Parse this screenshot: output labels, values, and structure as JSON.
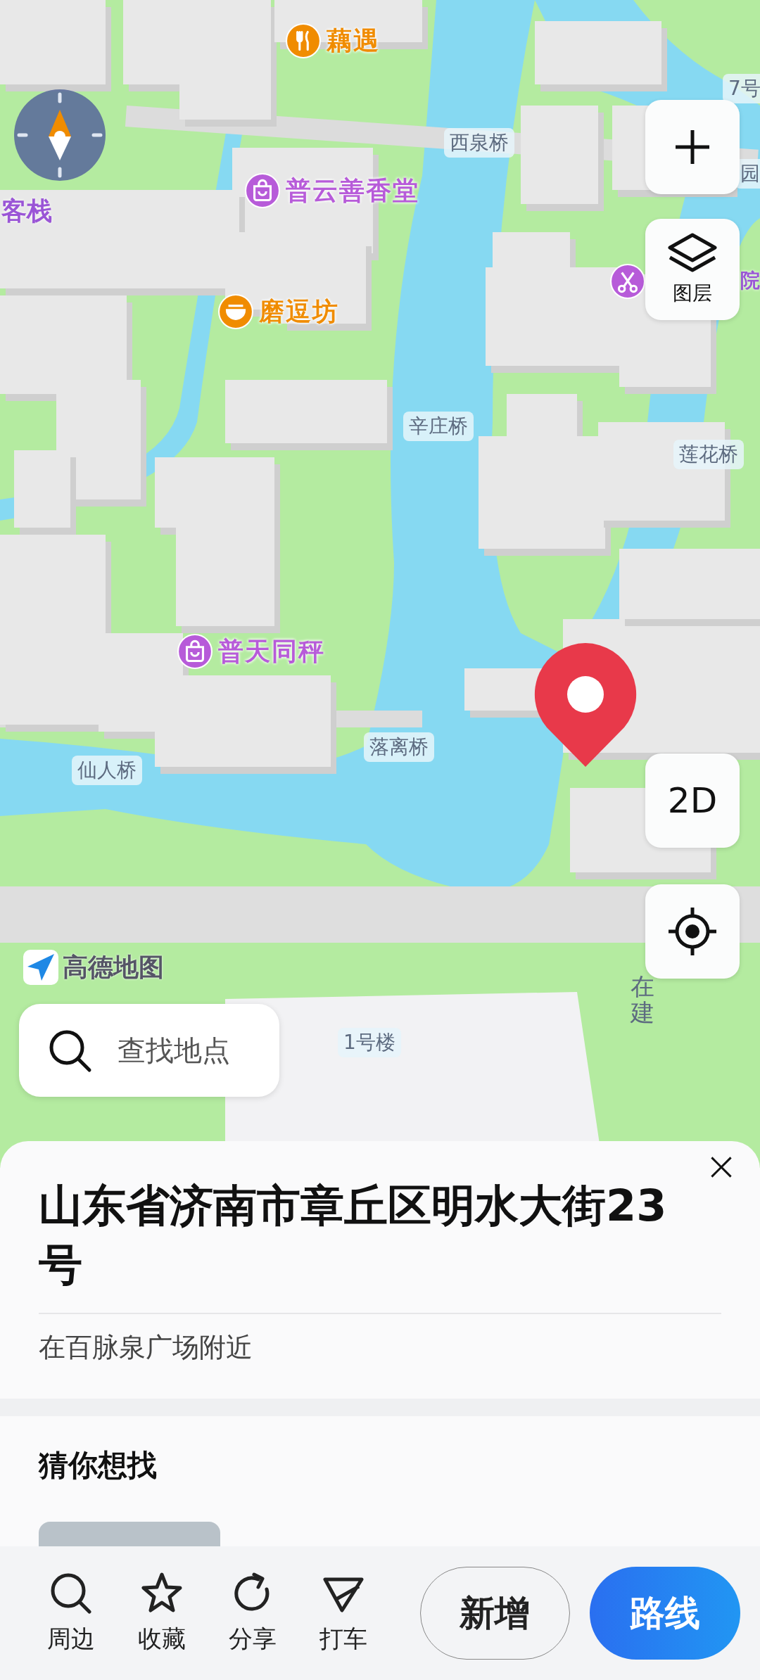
{
  "map": {
    "pois": [
      {
        "name": "藕遇",
        "kind": "food",
        "color": "#f08c00"
      },
      {
        "name": "普云善香堂",
        "kind": "shop",
        "color": "#b75bd9"
      },
      {
        "name": "磨逗坊",
        "kind": "noodles",
        "color": "#f08c00"
      },
      {
        "name": "普天同秤",
        "kind": "shop",
        "color": "#b75bd9"
      },
      {
        "kind": "salon",
        "color": "#b75bd9"
      }
    ],
    "labels": [
      {
        "text": "西泉桥",
        "kind": "bridge"
      },
      {
        "text": "辛庄桥",
        "kind": "bridge"
      },
      {
        "text": "莲花桥",
        "kind": "bridge"
      },
      {
        "text": "落离桥",
        "kind": "bridge"
      },
      {
        "text": "仙人桥",
        "kind": "bridge"
      },
      {
        "text": "1号楼",
        "kind": "bridge"
      },
      {
        "text": "7号",
        "kind": "bridge"
      },
      {
        "text": "园",
        "kind": "bridge"
      },
      {
        "text": "客栈",
        "kind": "place"
      },
      {
        "text": "院",
        "kind": "place"
      }
    ],
    "vertical_label": "在建",
    "logo": "高德地图"
  },
  "controls": {
    "layers_label": "图层",
    "mode_label": "2D"
  },
  "search": {
    "placeholder": "查找地点"
  },
  "sheet": {
    "title": "山东省济南市章丘区明水大街23号",
    "subtitle": "在百脉泉广场附近",
    "section_title": "猜你想找"
  },
  "bottom_bar": {
    "actions": [
      {
        "label": "周边",
        "kind": "nearby"
      },
      {
        "label": "收藏",
        "kind": "favorite"
      },
      {
        "label": "分享",
        "kind": "share"
      },
      {
        "label": "打车",
        "kind": "taxi"
      }
    ],
    "secondary_button": "新增",
    "primary_button": "路线"
  }
}
